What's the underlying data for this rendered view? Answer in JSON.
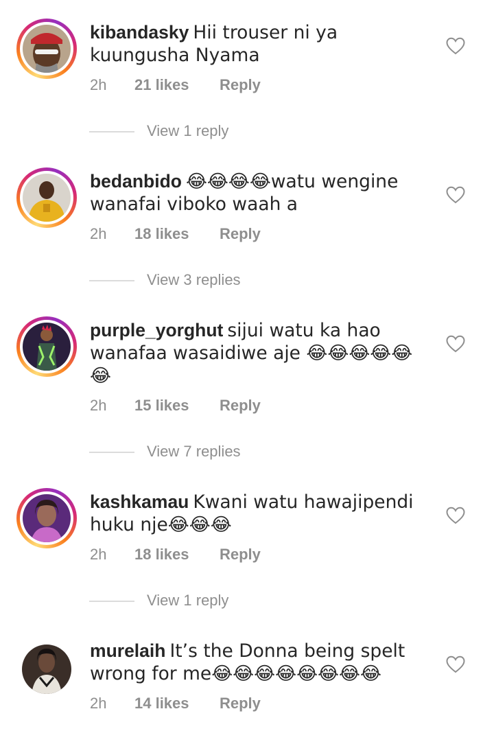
{
  "comments": [
    {
      "username": "kibandasky",
      "text": "Hii trouser ni ya kuungusha Nyama",
      "time": "2h",
      "likes": "21 likes",
      "reply_label": "Reply",
      "view_replies": "View 1 reply",
      "avatar_icon": "avatar-man-cap",
      "story_ring": true
    },
    {
      "username": "bedanbido",
      "text": "😂😂😂😂watu wengine wanafai viboko waah a",
      "time": "2h",
      "likes": "18 likes",
      "reply_label": "Reply",
      "view_replies": "View 3 replies",
      "avatar_icon": "avatar-yellow-hoodie",
      "story_ring": true
    },
    {
      "username": "purple_yorghut",
      "text": "sijui watu ka hao wanafaa wasaidiwe aje 😂😂😂😂😂😂",
      "time": "2h",
      "likes": "15 likes",
      "reply_label": "Reply",
      "view_replies": "View 7 replies",
      "avatar_icon": "avatar-neon-figure",
      "story_ring": true
    },
    {
      "username": "kashkamau",
      "text": "Kwani watu hawajipendi huku nje😂😂😂",
      "time": "2h",
      "likes": "18 likes",
      "reply_label": "Reply",
      "view_replies": "View 1 reply",
      "avatar_icon": "avatar-woman-purple",
      "story_ring": true
    },
    {
      "username": "murelaih",
      "text": "It’s the Donna being spelt wrong for me😂😂😂😂😂😂😂😂",
      "time": "2h",
      "likes": "14 likes",
      "reply_label": "Reply",
      "view_replies": "",
      "avatar_icon": "avatar-woman-dark",
      "story_ring": false
    }
  ],
  "colors": {
    "text": "#262626",
    "secondary": "#8e8e8e",
    "divider": "#dbdbdb"
  },
  "icons": {
    "like": "heart-outline-icon"
  }
}
